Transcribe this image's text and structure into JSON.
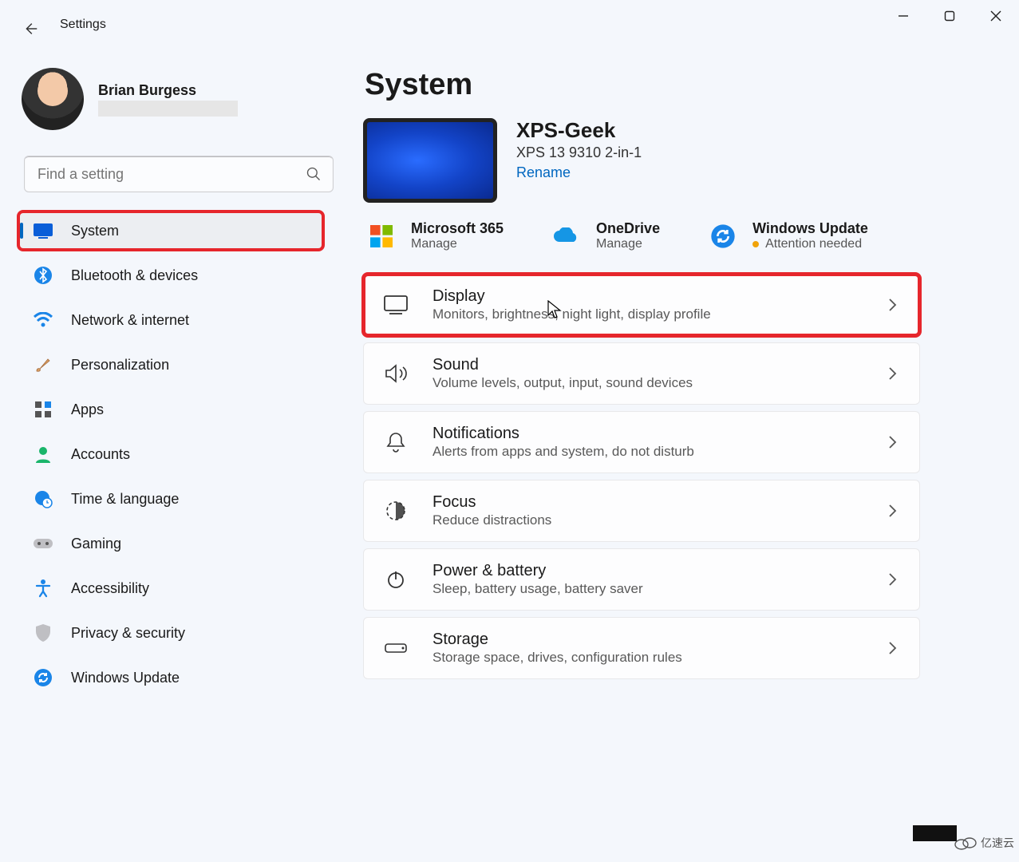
{
  "app": {
    "title": "Settings"
  },
  "user": {
    "name": "Brian Burgess"
  },
  "search": {
    "placeholder": "Find a setting"
  },
  "sidebar": {
    "items": [
      {
        "id": "system",
        "label": "System",
        "selected": true,
        "highlight": true
      },
      {
        "id": "bluetooth",
        "label": "Bluetooth & devices",
        "selected": false,
        "highlight": false
      },
      {
        "id": "network",
        "label": "Network & internet",
        "selected": false,
        "highlight": false
      },
      {
        "id": "personalize",
        "label": "Personalization",
        "selected": false,
        "highlight": false
      },
      {
        "id": "apps",
        "label": "Apps",
        "selected": false,
        "highlight": false
      },
      {
        "id": "accounts",
        "label": "Accounts",
        "selected": false,
        "highlight": false
      },
      {
        "id": "time",
        "label": "Time & language",
        "selected": false,
        "highlight": false
      },
      {
        "id": "gaming",
        "label": "Gaming",
        "selected": false,
        "highlight": false
      },
      {
        "id": "accessibility",
        "label": "Accessibility",
        "selected": false,
        "highlight": false
      },
      {
        "id": "privacy",
        "label": "Privacy & security",
        "selected": false,
        "highlight": false
      },
      {
        "id": "update",
        "label": "Windows Update",
        "selected": false,
        "highlight": false
      }
    ]
  },
  "page": {
    "title": "System",
    "device": {
      "name": "XPS-Geek",
      "model": "XPS 13 9310 2-in-1",
      "rename": "Rename"
    },
    "quick": [
      {
        "id": "m365",
        "title": "Microsoft 365",
        "sub": "Manage",
        "attention": false
      },
      {
        "id": "onedrive",
        "title": "OneDrive",
        "sub": "Manage",
        "attention": false
      },
      {
        "id": "update",
        "title": "Windows Update",
        "sub": "Attention needed",
        "attention": true
      }
    ],
    "cards": [
      {
        "id": "display",
        "title": "Display",
        "sub": "Monitors, brightness, night light, display profile",
        "highlight": true
      },
      {
        "id": "sound",
        "title": "Sound",
        "sub": "Volume levels, output, input, sound devices",
        "highlight": false
      },
      {
        "id": "notifications",
        "title": "Notifications",
        "sub": "Alerts from apps and system, do not disturb",
        "highlight": false
      },
      {
        "id": "focus",
        "title": "Focus",
        "sub": "Reduce distractions",
        "highlight": false
      },
      {
        "id": "power",
        "title": "Power & battery",
        "sub": "Sleep, battery usage, battery saver",
        "highlight": false
      },
      {
        "id": "storage",
        "title": "Storage",
        "sub": "Storage space, drives, configuration rules",
        "highlight": false
      }
    ]
  },
  "watermark": "亿速云"
}
